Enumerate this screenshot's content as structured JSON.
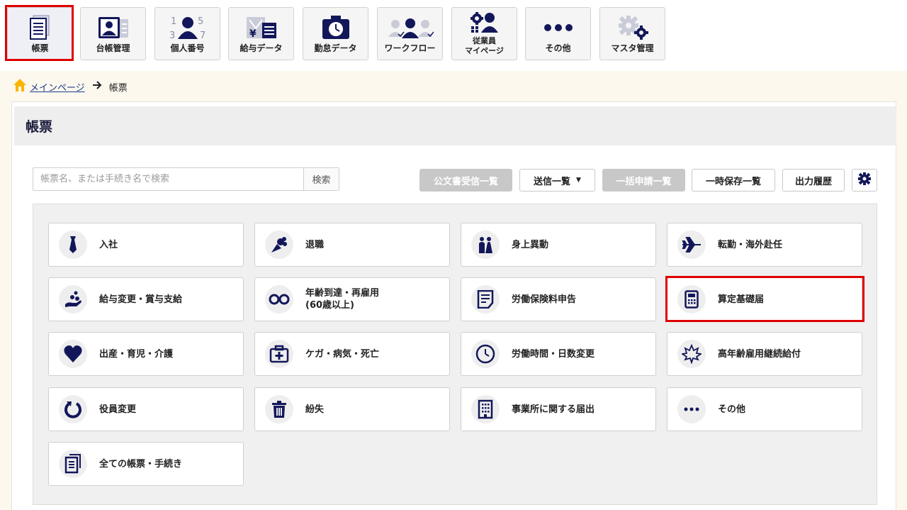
{
  "nav": {
    "items": [
      {
        "label": "帳票"
      },
      {
        "label": "台帳管理"
      },
      {
        "label": "個人番号"
      },
      {
        "label": "給与データ"
      },
      {
        "label": "勤怠データ"
      },
      {
        "label": "ワークフロー"
      },
      {
        "label_line1": "従業員",
        "label_line2": "マイページ"
      },
      {
        "label": "その他"
      },
      {
        "label": "マスタ管理"
      }
    ]
  },
  "breadcrumb": {
    "home": "メインページ",
    "current": "帳票"
  },
  "page": {
    "title": "帳票"
  },
  "search": {
    "placeholder": "帳票名、または手続き名で検索",
    "value": "",
    "button": "検索"
  },
  "toolbar": {
    "public_docs": "公文書受信一覧",
    "send_list": "送信一覧",
    "bulk_apply": "一括申請一覧",
    "temp_saved": "一時保存一覧",
    "output_history": "出力履歴"
  },
  "cards": [
    {
      "label": "入社"
    },
    {
      "label": "退職"
    },
    {
      "label": "身上異動"
    },
    {
      "label": "転勤・海外赴任"
    },
    {
      "label": "給与変更・賞与支給"
    },
    {
      "label": "年齢到達・再雇用\n(60歳以上)"
    },
    {
      "label": "労働保険料申告"
    },
    {
      "label": "算定基礎届"
    },
    {
      "label": "出産・育児・介護"
    },
    {
      "label": "ケガ・病気・死亡"
    },
    {
      "label": "労働時間・日数変更"
    },
    {
      "label": "高年齢雇用継続給付"
    },
    {
      "label": "役員変更"
    },
    {
      "label": "紛失"
    },
    {
      "label": "事業所に関する届出"
    },
    {
      "label": "その他"
    },
    {
      "label": "全ての帳票・手続き"
    }
  ],
  "colors": {
    "icon": "#13175a",
    "highlight": "#e00000",
    "breadcrumb_bg": "#fdf8ee",
    "disabled_button": "#c8c8c8"
  }
}
